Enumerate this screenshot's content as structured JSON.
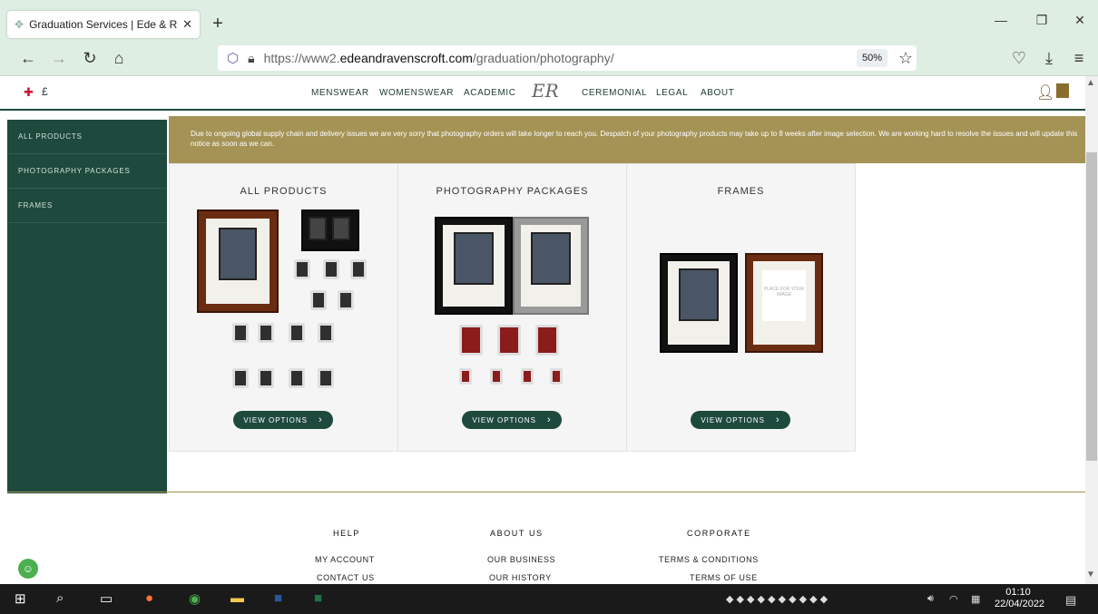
{
  "browser": {
    "tab_title": "Graduation Services | Ede & Rav",
    "new_tab": "+",
    "url_prefix": "https://www2.",
    "url_domain": "edeandravenscroft.com",
    "url_path": "/graduation/photography/",
    "zoom": "50%"
  },
  "site": {
    "currency": "£",
    "logo": "ER",
    "menu": [
      "MENSWEAR",
      "WOMENSWEAR",
      "ACADEMIC",
      "CEREMONIAL",
      "LEGAL",
      "ABOUT"
    ]
  },
  "sidebar": {
    "items": [
      "ALL PRODUCTS",
      "PHOTOGRAPHY PACKAGES",
      "FRAMES"
    ]
  },
  "notice": "Due to ongoing global supply chain and delivery issues we are very sorry that photography orders will take longer to reach you. Despatch of your photography products may take up to 8 weeks after image selection. We are working hard to resolve the issues and will update this notice as soon as we can.",
  "cards": [
    {
      "title": "ALL PRODUCTS",
      "button": "VIEW OPTIONS"
    },
    {
      "title": "PHOTOGRAPHY PACKAGES",
      "button": "VIEW OPTIONS"
    },
    {
      "title": "FRAMES",
      "button": "VIEW OPTIONS"
    }
  ],
  "frame_placeholder": "PLACE FOR YOUR IMAGE",
  "footer": {
    "columns": [
      {
        "heading": "HELP",
        "links": [
          "MY ACCOUNT",
          "CONTACT US"
        ]
      },
      {
        "heading": "ABOUT US",
        "links": [
          "OUR BUSINESS",
          "OUR HISTORY"
        ]
      },
      {
        "heading": "CORPORATE",
        "links": [
          "TERMS & CONDITIONS",
          "TERMS OF USE"
        ]
      }
    ]
  },
  "taskbar": {
    "time": "01:10",
    "date": "22/04/2022"
  }
}
